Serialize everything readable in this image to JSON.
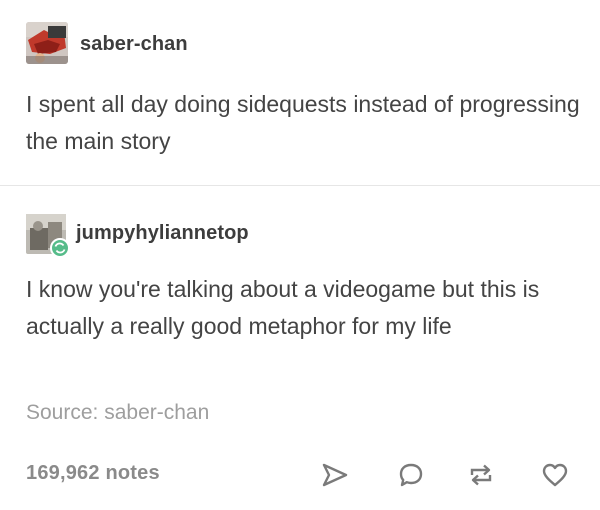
{
  "post_1": {
    "username": "saber-chan",
    "text": "I spent all day doing sidequests instead of progressing the main story"
  },
  "post_2": {
    "username": "jumpyhyliannetop",
    "text": "I know you're talking about a videogame but this is actually a really good metaphor for my life",
    "source": "Source: saber-chan"
  },
  "footer": {
    "notes": "169,962 notes",
    "actions": [
      "share-icon",
      "reply-icon",
      "reblog-icon",
      "heart-icon"
    ]
  },
  "colors": {
    "text": "#444444",
    "muted": "#9e9e9e",
    "reblog_badge": "#56bc8a"
  }
}
